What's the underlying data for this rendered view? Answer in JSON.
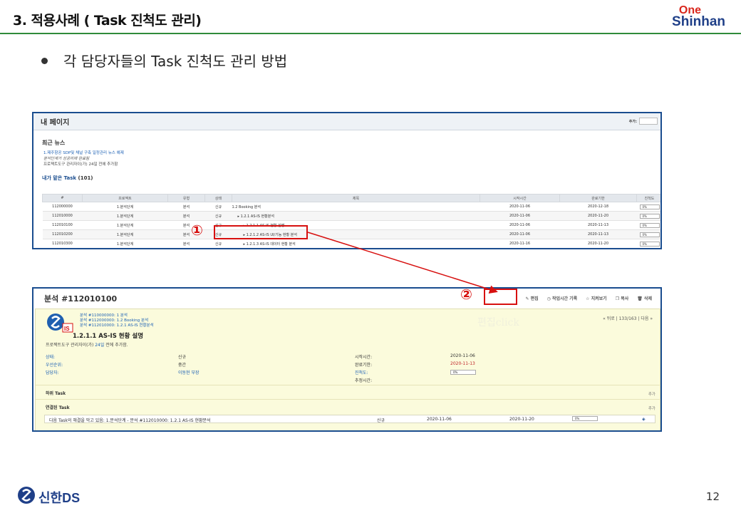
{
  "slide": {
    "title": "3. 적용사례 ( Task 진척도 관리)",
    "logo_one": "One",
    "logo_shinhan": "Shinhan",
    "bullet": "각 담당자들의 Task 진척도 관리 방법",
    "footer_brand": "신한DS",
    "page_number": "12",
    "marker1": "①",
    "marker2": "②"
  },
  "colors": {
    "accent_green": "#2f8b3a",
    "highlight_red": "#d7100f",
    "brand_blue": "#1f3f88"
  },
  "mypage": {
    "title": "내 페이지",
    "search_label": "추가:",
    "news_title": "최근 뉴스",
    "news": [
      "1.제주항공 SDP및 채널 구축 일정관리 뉴스 예제",
      "분석단계가 성공리에 완료됨",
      "프로젝트도구 관리자이(가) 24일 전에 추가함"
    ],
    "task_title": "내가 맡은 Task",
    "task_count": "(101)",
    "columns": [
      "#",
      "프로젝트",
      "유형",
      "상태",
      "제목",
      "시작시간",
      "완료기한",
      "진척도"
    ],
    "rows": [
      {
        "id": "112000000",
        "project": "1.분석단계",
        "type": "분석",
        "status": "신규",
        "subject": "1.2 Booking 분석",
        "start": "2020-11-06",
        "due": "2020-12-18",
        "progress": "0%"
      },
      {
        "id": "112010000",
        "project": "1.분석단계",
        "type": "분석",
        "status": "신규",
        "subject": "▸ 1.2.1 AS-IS 현황분석",
        "start": "2020-11-06",
        "due": "2020-11-20",
        "progress": "0%"
      },
      {
        "id": "112010100",
        "project": "1.분석단계",
        "type": "분석",
        "status": "신규",
        "subject": "▸ 1.2.1.1 AS-IS 현황 설명",
        "start": "2020-11-06",
        "due": "2020-11-13",
        "progress": "0%"
      },
      {
        "id": "112010200",
        "project": "1.분석단계",
        "type": "분석",
        "status": "신규",
        "subject": "▸ 1.2.1.2 AS-IS UI/기능 현황 분석",
        "start": "2020-11-06",
        "due": "2020-11-13",
        "progress": "0%"
      },
      {
        "id": "112010300",
        "project": "1.분석단계",
        "type": "분석",
        "status": "신규",
        "subject": "▸ 1.2.1.3 AS-IS 데이터 현황 분석",
        "start": "2020-11-16",
        "due": "2020-11-20",
        "progress": "0%"
      }
    ]
  },
  "issue": {
    "title": "분석 #112010100",
    "actions": [
      "편집",
      "작업시간 기록",
      "지켜보기",
      "복사",
      "삭제"
    ],
    "edit_click_label": "편집click",
    "nav": "« 뒤로 | 133/163 | 다음 »",
    "crumbs": [
      "분석 #110000000: 1 분석",
      "분석 #112000000: 1.2 Booking 분석",
      "분석 #112010000: 1.2.1 AS-IS 현황분석"
    ],
    "subject": "1.2.1.1 AS-IS 현황 설명",
    "creator_prefix": "프로젝트도구 관리자이(가) ",
    "creator_link": "24일",
    "creator_suffix": " 전에 추가함.",
    "fields_left": [
      {
        "label": "상태:",
        "value": "신규"
      },
      {
        "label": "우선순위:",
        "value": "중간"
      },
      {
        "label": "담당자:",
        "value": "이동현 부장"
      }
    ],
    "fields_right": [
      {
        "label": "시작시간:",
        "value": "2020-11-06"
      },
      {
        "label": "완료기한:",
        "value": "2020-11-13"
      },
      {
        "label": "진척도:",
        "value": "0%"
      },
      {
        "label": "추정시간:",
        "value": ""
      }
    ],
    "subtask_label": "하위 Task",
    "related_label": "연결된 Task",
    "add_label": "추가",
    "related": {
      "text": "다음 Task의 해결을 막고 있음: 1.분석단계 - 분석 #112010000: 1.2.1 AS-IS 현황분석",
      "status": "신규",
      "start": "2020-11-06",
      "due": "2020-11-20",
      "progress": "0%"
    }
  }
}
